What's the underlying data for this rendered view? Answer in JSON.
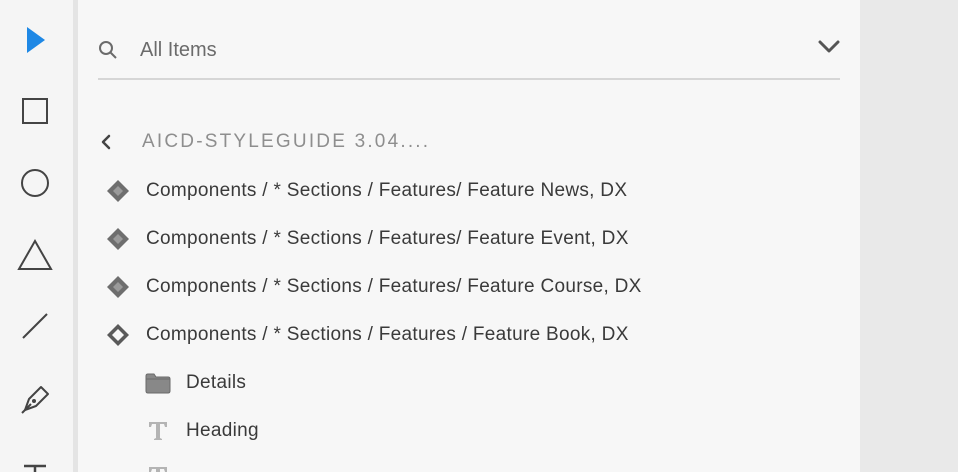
{
  "toolbar": {
    "tools": [
      {
        "name": "select-tool",
        "icon": "arrow-pointer-icon",
        "active": true
      },
      {
        "name": "rectangle-tool",
        "icon": "rectangle-icon"
      },
      {
        "name": "ellipse-tool",
        "icon": "ellipse-icon"
      },
      {
        "name": "polygon-tool",
        "icon": "triangle-icon"
      },
      {
        "name": "line-tool",
        "icon": "line-icon"
      },
      {
        "name": "pen-tool",
        "icon": "pen-icon"
      },
      {
        "name": "text-tool",
        "icon": "text-icon"
      }
    ],
    "accent_color": "#1473e6"
  },
  "layers": {
    "search": {
      "placeholder": "All Items",
      "icon": "search-icon",
      "dropdown_icon": "chevron-down-icon"
    },
    "breadcrumb": {
      "back_icon": "chevron-left-icon",
      "label": "AICD-STYLEGUIDE 3.04...."
    },
    "items": [
      {
        "label": "Components / * Sections / Features/ Feature News, DX",
        "icon": "component-instance-icon"
      },
      {
        "label": "Components / * Sections / Features/ Feature Event, DX",
        "icon": "component-instance-icon"
      },
      {
        "label": "Components / * Sections / Features/ Feature Course, DX",
        "icon": "component-instance-icon"
      },
      {
        "label": "Components / * Sections / Features / Feature Book, DX",
        "icon": "component-main-icon"
      }
    ],
    "children": [
      {
        "label": "Details",
        "icon": "folder-icon"
      },
      {
        "label": "Heading",
        "icon": "text-layer-icon"
      },
      {
        "label": "",
        "icon": "text-layer-icon"
      }
    ]
  }
}
